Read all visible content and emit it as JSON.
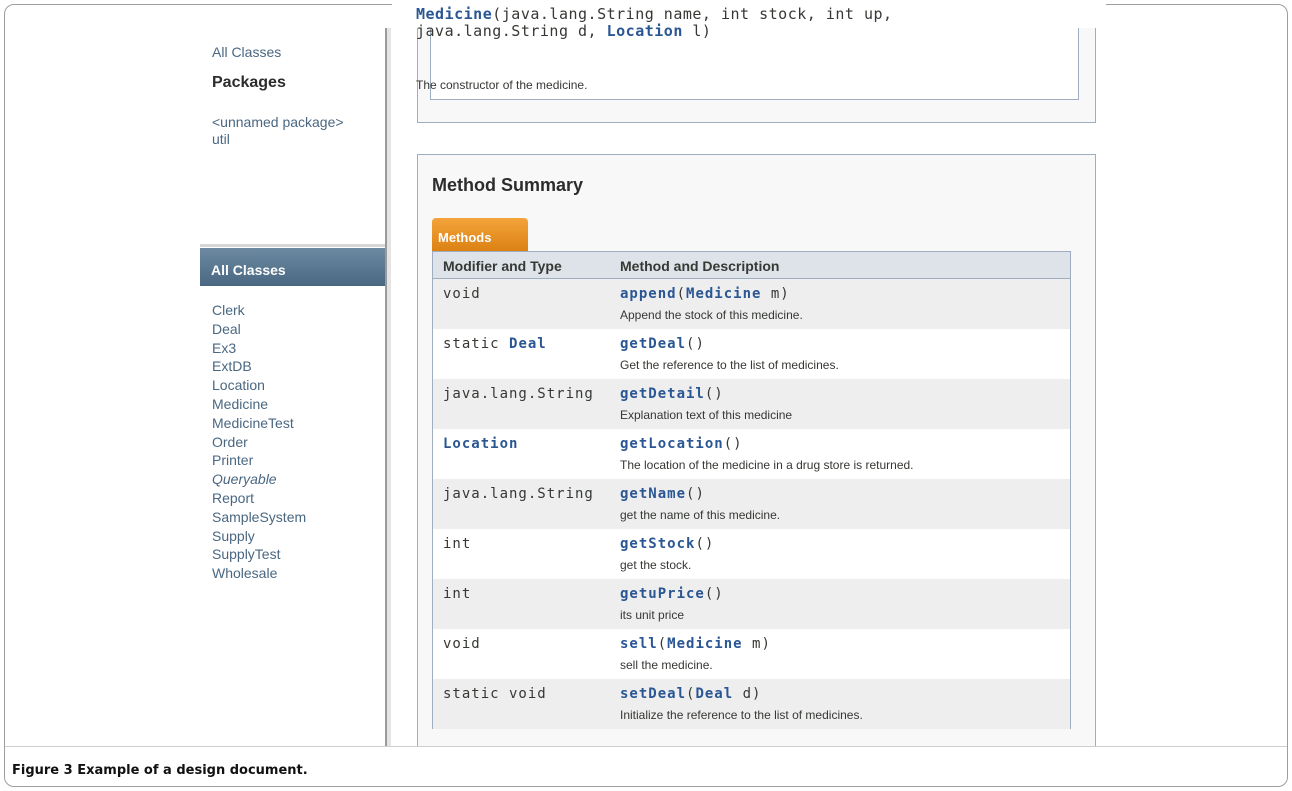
{
  "nav": {
    "all_classes_link": "All Classes",
    "packages_heading": "Packages",
    "packages": [
      "<unnamed package>",
      "util"
    ],
    "all_classes_header": "All Classes",
    "classes": [
      {
        "name": "Clerk",
        "italic": false
      },
      {
        "name": "Deal",
        "italic": false
      },
      {
        "name": "Ex3",
        "italic": false
      },
      {
        "name": "ExtDB",
        "italic": false
      },
      {
        "name": "Location",
        "italic": false
      },
      {
        "name": "Medicine",
        "italic": false
      },
      {
        "name": "MedicineTest",
        "italic": false
      },
      {
        "name": "Order",
        "italic": false
      },
      {
        "name": "Printer",
        "italic": false
      },
      {
        "name": "Queryable",
        "italic": true
      },
      {
        "name": "Report",
        "italic": false
      },
      {
        "name": "SampleSystem",
        "italic": false
      },
      {
        "name": "Supply",
        "italic": false
      },
      {
        "name": "SupplyTest",
        "italic": false
      },
      {
        "name": "Wholesale",
        "italic": false
      }
    ]
  },
  "constructor": {
    "name": "Medicine",
    "params_part1": "(java.lang.String name, int stock, int up,",
    "params_part2": "java.lang.String d, ",
    "param_type": "Location",
    "params_end": " l)",
    "description": "The constructor of the medicine."
  },
  "method_summary": {
    "title": "Method Summary",
    "tab": "Methods",
    "col_type": "Modifier and Type",
    "col_method": "Method and Description",
    "rows": [
      {
        "type": "void",
        "type_link": "",
        "name": "append",
        "params": [
          {
            "t": "(",
            "link": false
          },
          {
            "t": "Medicine",
            "link": true
          },
          {
            "t": " m)",
            "link": false
          }
        ],
        "description": "Append the stock of this medicine."
      },
      {
        "type": "static ",
        "type_link": "Deal",
        "name": "getDeal",
        "params": [
          {
            "t": "()",
            "link": false
          }
        ],
        "description": "Get the reference to the list of medicines."
      },
      {
        "type": "java.lang.String",
        "type_link": "",
        "name": "getDetail",
        "params": [
          {
            "t": "()",
            "link": false
          }
        ],
        "description": "Explanation text of this medicine"
      },
      {
        "type": "",
        "type_link": "Location",
        "name": "getLocation",
        "params": [
          {
            "t": "()",
            "link": false
          }
        ],
        "description": "The location of the medicine in a drug store is returned."
      },
      {
        "type": "java.lang.String",
        "type_link": "",
        "name": "getName",
        "params": [
          {
            "t": "()",
            "link": false
          }
        ],
        "description": "get the name of this medicine."
      },
      {
        "type": "int",
        "type_link": "",
        "name": "getStock",
        "params": [
          {
            "t": "()",
            "link": false
          }
        ],
        "description": "get the stock."
      },
      {
        "type": "int",
        "type_link": "",
        "name": "getuPrice",
        "params": [
          {
            "t": "()",
            "link": false
          }
        ],
        "description": "its unit price"
      },
      {
        "type": "void",
        "type_link": "",
        "name": "sell",
        "params": [
          {
            "t": "(",
            "link": false
          },
          {
            "t": "Medicine",
            "link": true
          },
          {
            "t": " m)",
            "link": false
          }
        ],
        "description": "sell the medicine."
      },
      {
        "type": "static void",
        "type_link": "",
        "name": "setDeal",
        "params": [
          {
            "t": "(",
            "link": false
          },
          {
            "t": "Deal",
            "link": true
          },
          {
            "t": " d)",
            "link": false
          }
        ],
        "description": "Initialize the reference to the list of medicines."
      }
    ]
  },
  "caption": {
    "label": "Figure 3",
    "text": " Example of a design document."
  }
}
